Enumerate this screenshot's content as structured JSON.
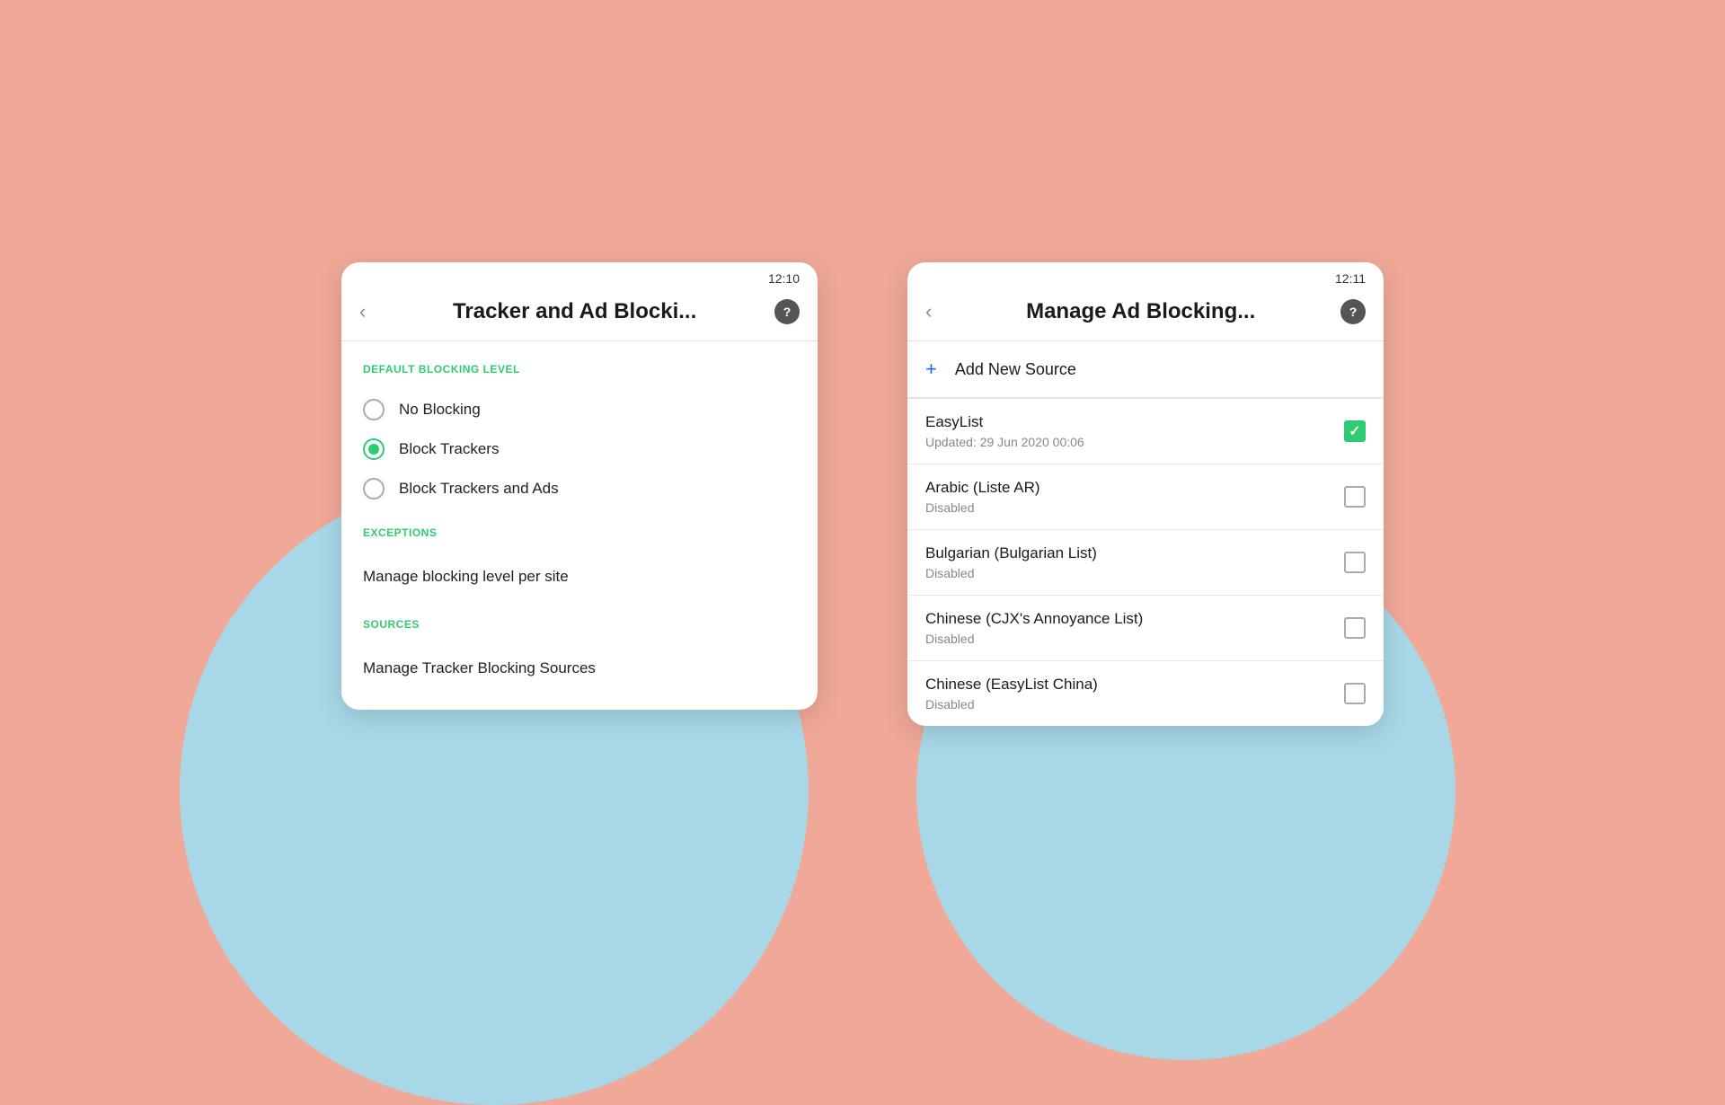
{
  "background": {
    "color": "#f0a898"
  },
  "screen_left": {
    "status_time": "12:10",
    "header": {
      "title": "Tracker and Ad Blocki...",
      "back_label": "‹",
      "help_label": "?"
    },
    "sections": {
      "blocking_level": {
        "label": "DEFAULT BLOCKING LEVEL",
        "options": [
          {
            "id": "no-blocking",
            "label": "No Blocking",
            "selected": false
          },
          {
            "id": "block-trackers",
            "label": "Block Trackers",
            "selected": true
          },
          {
            "id": "block-trackers-ads",
            "label": "Block Trackers and Ads",
            "selected": false
          }
        ]
      },
      "exceptions": {
        "label": "EXCEPTIONS",
        "items": [
          {
            "id": "manage-blocking",
            "label": "Manage blocking level per site"
          }
        ]
      },
      "sources": {
        "label": "SOURCES",
        "items": [
          {
            "id": "manage-sources",
            "label": "Manage Tracker Blocking Sources"
          }
        ]
      }
    }
  },
  "screen_right": {
    "status_time": "12:11",
    "header": {
      "title": "Manage Ad Blocking...",
      "back_label": "‹",
      "help_label": "?"
    },
    "add_new_source": {
      "plus_icon": "+",
      "label": "Add New Source"
    },
    "sources": [
      {
        "id": "easylist",
        "name": "EasyList",
        "status": "Updated: 29 Jun 2020 00:06",
        "enabled": true
      },
      {
        "id": "arabic",
        "name": "Arabic (Liste AR)",
        "status": "Disabled",
        "enabled": false
      },
      {
        "id": "bulgarian",
        "name": "Bulgarian (Bulgarian List)",
        "status": "Disabled",
        "enabled": false
      },
      {
        "id": "chinese-cjx",
        "name": "Chinese (CJX's Annoyance List)",
        "status": "Disabled",
        "enabled": false
      },
      {
        "id": "chinese-easylist",
        "name": "Chinese (EasyList China)",
        "status": "Disabled",
        "enabled": false
      }
    ]
  }
}
